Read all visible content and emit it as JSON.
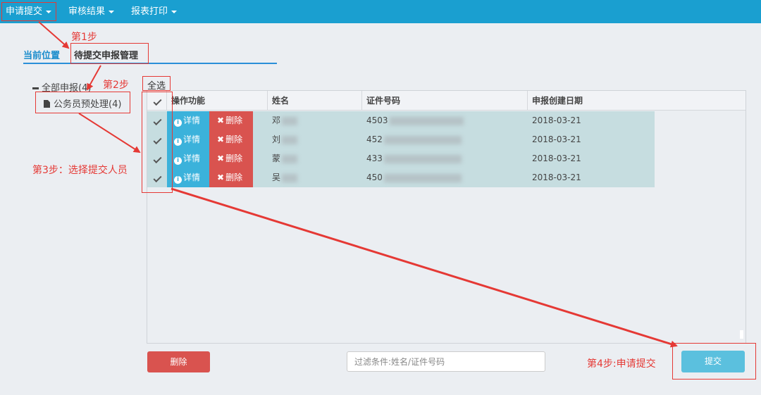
{
  "nav": {
    "items": [
      {
        "label": "申请提交"
      },
      {
        "label": "审核结果"
      },
      {
        "label": "报表打印"
      }
    ]
  },
  "breadcrumb": {
    "label": "当前位置",
    "title": "待提交申报管理"
  },
  "tree": {
    "root_label": "全部申报(4)",
    "child_label": "公务员预处理(4)"
  },
  "table": {
    "select_all_label": "全选",
    "columns": [
      "操作功能",
      "姓名",
      "证件号码",
      "申报创建日期"
    ],
    "detail_label": "详情",
    "delete_label": "删除",
    "rows": [
      {
        "name": "邓",
        "id": "4503",
        "date": "2018-03-21"
      },
      {
        "name": "刘",
        "id": "452",
        "date": "2018-03-21"
      },
      {
        "name": "蒙",
        "id": "433",
        "date": "2018-03-21"
      },
      {
        "name": "吴",
        "id": "450",
        "date": "2018-03-21"
      }
    ]
  },
  "bottom": {
    "delete_label": "删除",
    "filter_placeholder": "过滤条件:姓名/证件号码",
    "submit_label": "提交"
  },
  "annotations": {
    "step1": "第1步",
    "step2": "第2步",
    "step3": "第3步：选择提交人员",
    "step4": "第4步:申请提交"
  },
  "colors": {
    "nav_bg": "#1a9fd0",
    "row_bg": "#c6dde0",
    "detail_btn": "#3bb2db",
    "delete_btn": "#d9534f",
    "submit_btn": "#5bc0de",
    "annotation": "#e53935"
  }
}
